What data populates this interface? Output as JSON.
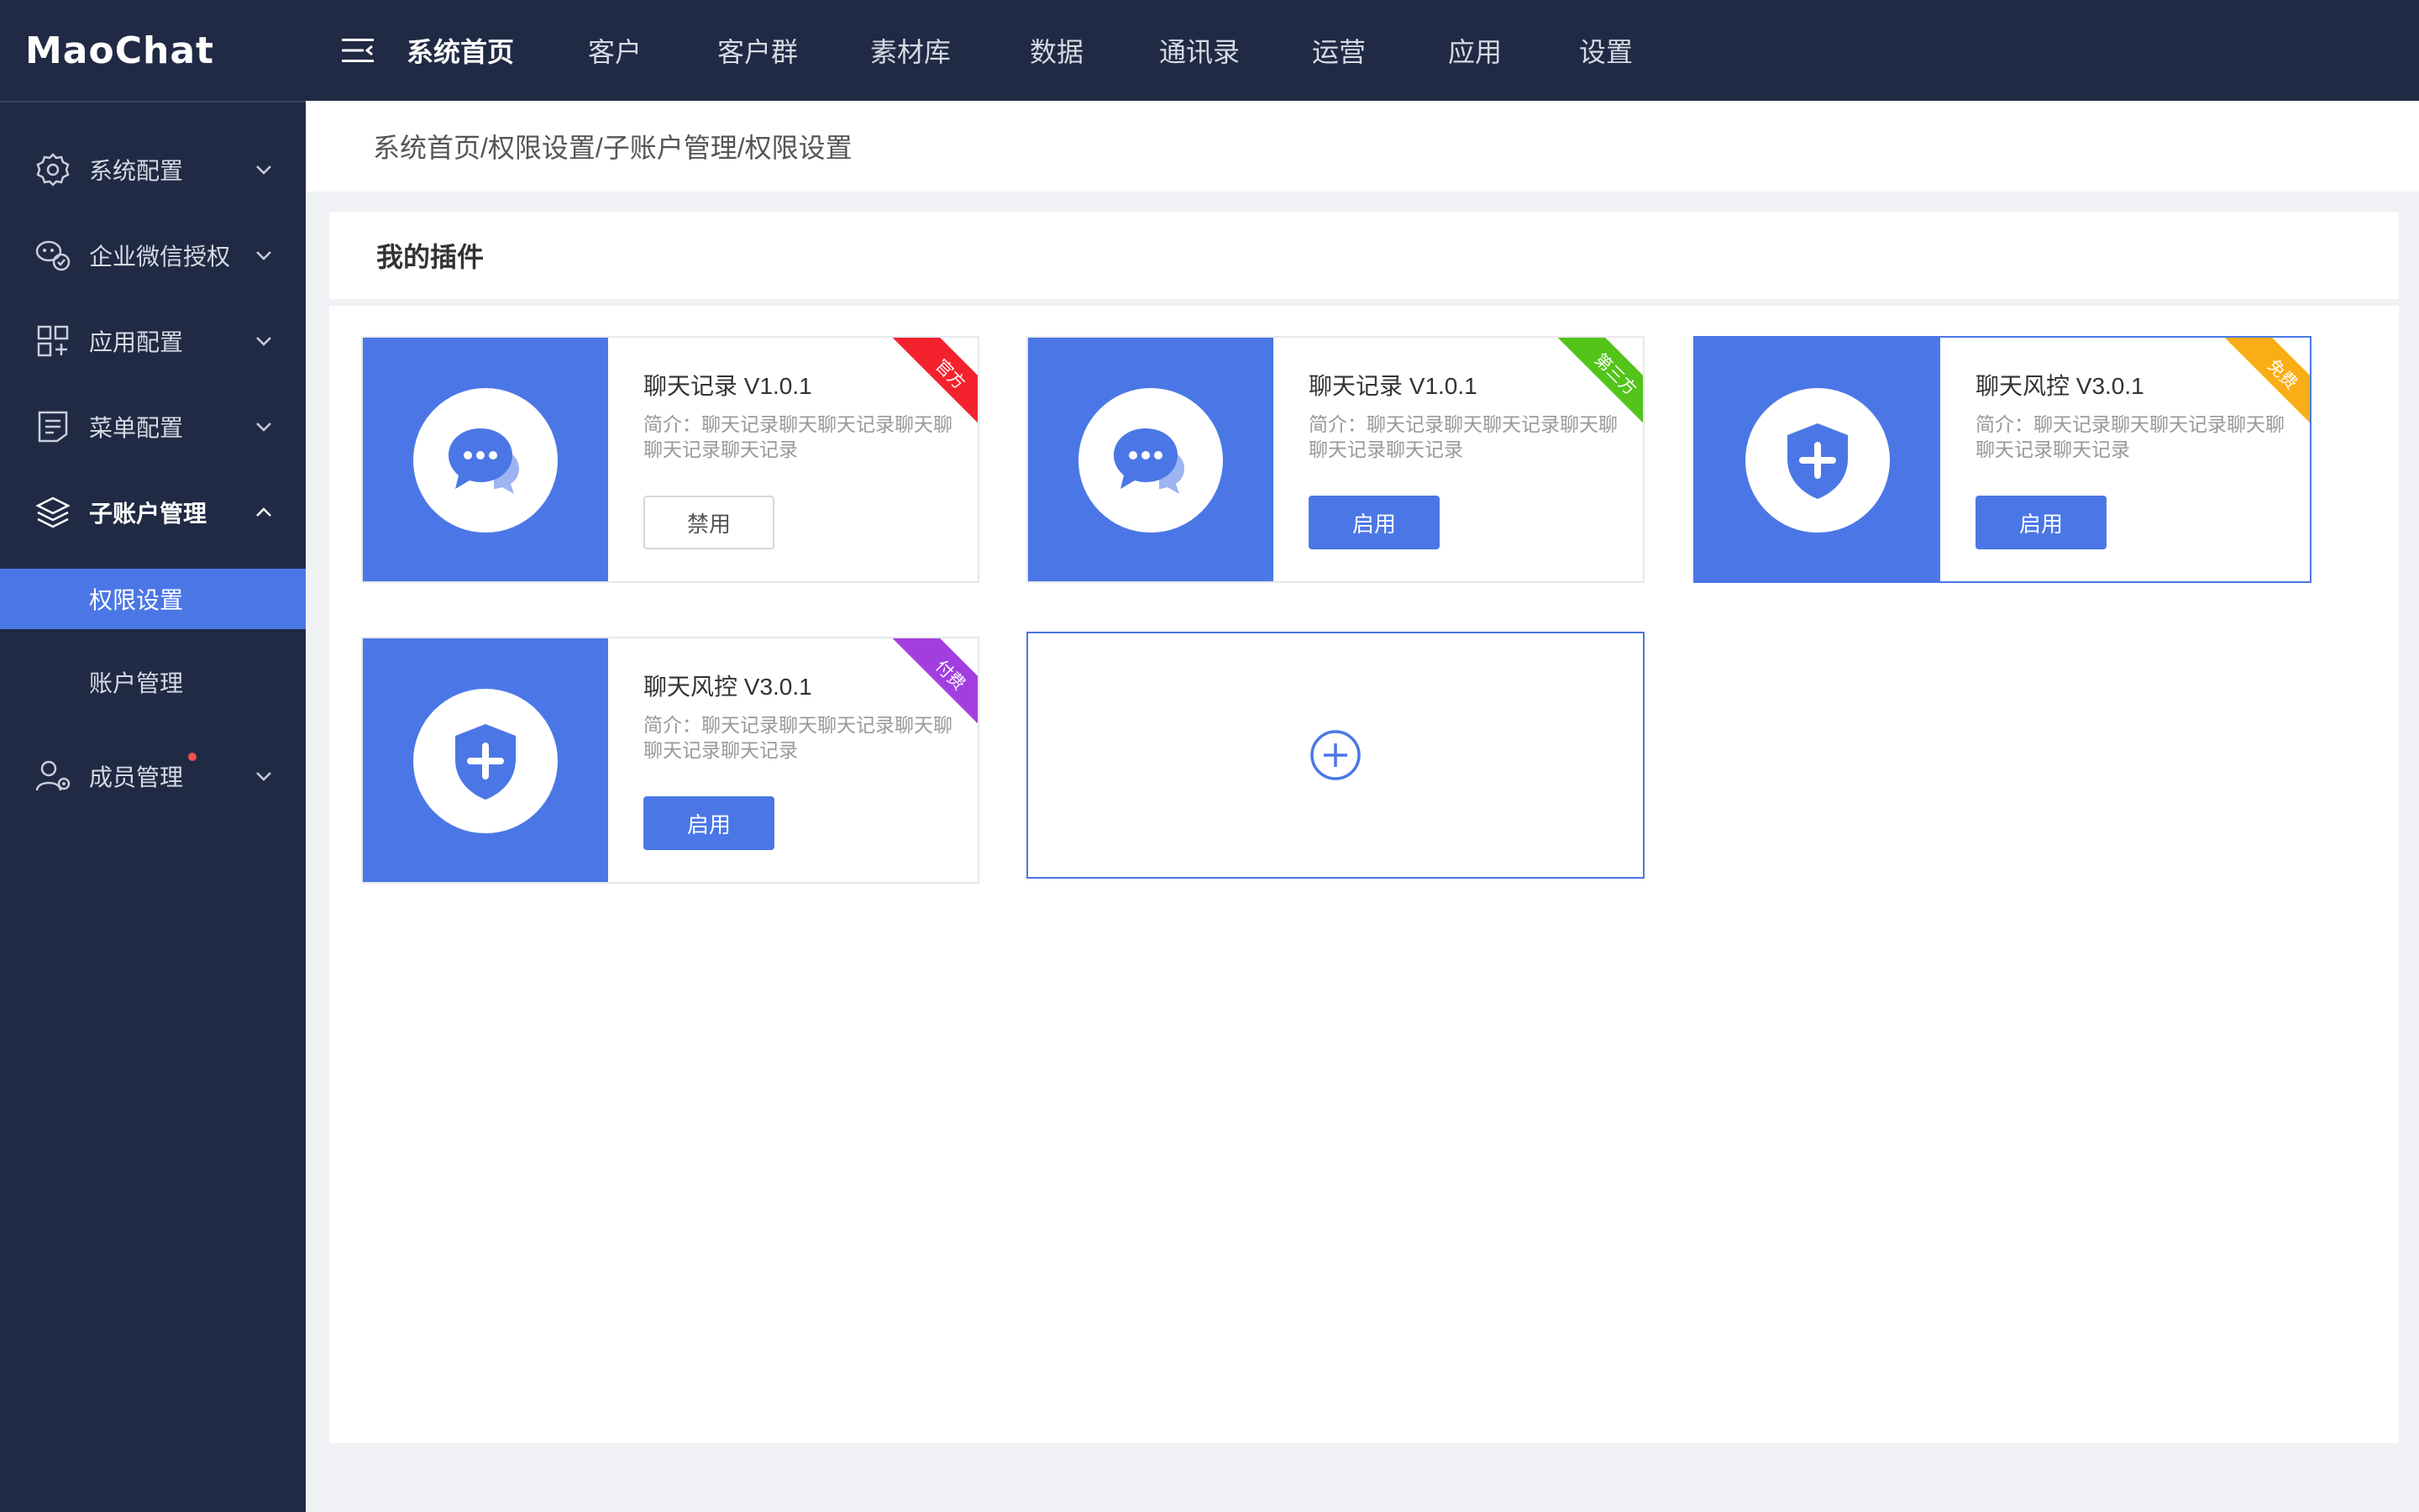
{
  "app": {
    "logo": "MaoChat"
  },
  "topnav": {
    "items": [
      {
        "label": "系统首页",
        "active": true
      },
      {
        "label": "客户"
      },
      {
        "label": "客户群"
      },
      {
        "label": "素材库"
      },
      {
        "label": "数据"
      },
      {
        "label": "通讯录"
      },
      {
        "label": "运营"
      },
      {
        "label": "应用"
      },
      {
        "label": "设置"
      }
    ]
  },
  "sidebar": {
    "items": [
      {
        "label": "系统配置",
        "icon": "gear-icon"
      },
      {
        "label": "企业微信授权",
        "icon": "wechat-icon"
      },
      {
        "label": "应用配置",
        "icon": "apps-icon"
      },
      {
        "label": "菜单配置",
        "icon": "document-icon"
      },
      {
        "label": "子账户管理",
        "icon": "layers-icon",
        "expanded": true,
        "children": [
          {
            "label": "权限设置",
            "active": true
          },
          {
            "label": "账户管理"
          }
        ]
      },
      {
        "label": "成员管理",
        "icon": "members-icon",
        "badge_dot": true
      }
    ]
  },
  "breadcrumb": {
    "text": "系统首页/权限设置/子账户管理/权限设置"
  },
  "plugins": {
    "title": "我的插件",
    "cards": [
      {
        "name": "聊天记录 V1.0.1",
        "desc": "简介：聊天记录聊天聊天记录聊天聊聊天记录聊天记录",
        "button": "禁用",
        "button_style": "plain",
        "ribbon": "官方",
        "ribbon_color": "#f5222d",
        "icon": "chat-bubbles-icon"
      },
      {
        "name": "聊天记录 V1.0.1",
        "desc": "简介：聊天记录聊天聊天记录聊天聊聊天记录聊天记录",
        "button": "启用",
        "button_style": "primary",
        "ribbon": "第三方",
        "ribbon_color": "#52c41a",
        "icon": "chat-bubbles-icon"
      },
      {
        "name": "聊天风控 V3.0.1",
        "desc": "简介：聊天记录聊天聊天记录聊天聊聊天记录聊天记录",
        "button": "启用",
        "button_style": "primary",
        "ribbon": "免费",
        "ribbon_color": "#faad14",
        "icon": "shield-plus-icon",
        "highlighted": true
      },
      {
        "name": "聊天风控 V3.0.1",
        "desc": "简介：聊天记录聊天聊天记录聊天聊聊天记录聊天记录",
        "button": "启用",
        "button_style": "primary",
        "ribbon": "付费",
        "ribbon_color": "#a23ee0",
        "icon": "shield-plus-icon"
      }
    ],
    "add_icon": "plus-circle-icon"
  },
  "colors": {
    "topbar_bg": "#202a44",
    "accent": "#4b77e6",
    "page_bg": "#f0f1f4"
  }
}
